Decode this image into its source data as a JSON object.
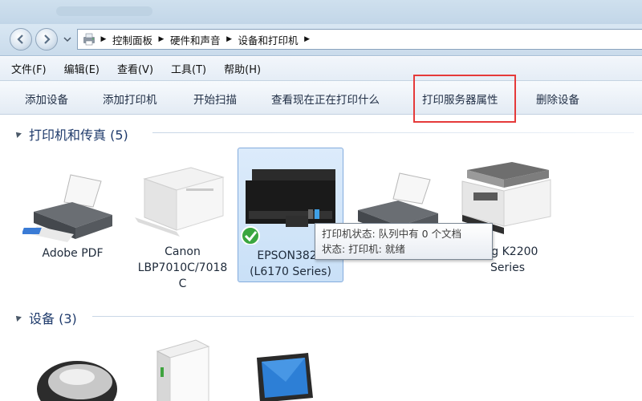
{
  "address_bar": {
    "breadcrumbs": [
      "控制面板",
      "硬件和声音",
      "设备和打印机"
    ]
  },
  "menubar": {
    "items": [
      "文件(F)",
      "编辑(E)",
      "查看(V)",
      "工具(T)",
      "帮助(H)"
    ]
  },
  "commandbar": {
    "add_device": "添加设备",
    "add_printer": "添加打印机",
    "start_scan": "开始扫描",
    "see_printing": "查看现在正在打印什么",
    "print_server_props": "打印服务器属性",
    "remove_device": "删除设备"
  },
  "printers_group": {
    "title": "打印机和传真 (5)",
    "items": [
      {
        "label": "Adobe PDF"
      },
      {
        "label": "Canon\nLBP7010C/7018\nC"
      },
      {
        "label": "EPSON3826\n(L6170 Series)"
      },
      {
        "label": ""
      },
      {
        "label": "ung K2200\nSeries"
      }
    ]
  },
  "devices_group": {
    "title": "设备 (3)"
  },
  "tooltip": {
    "line1": "打印机状态: 队列中有 0 个文档",
    "line2": "状态: 打印机: 就绪"
  },
  "colors": {
    "highlight": "#e53a3a",
    "selection": "#c9e0f7",
    "group_title": "#1e3a6b"
  }
}
